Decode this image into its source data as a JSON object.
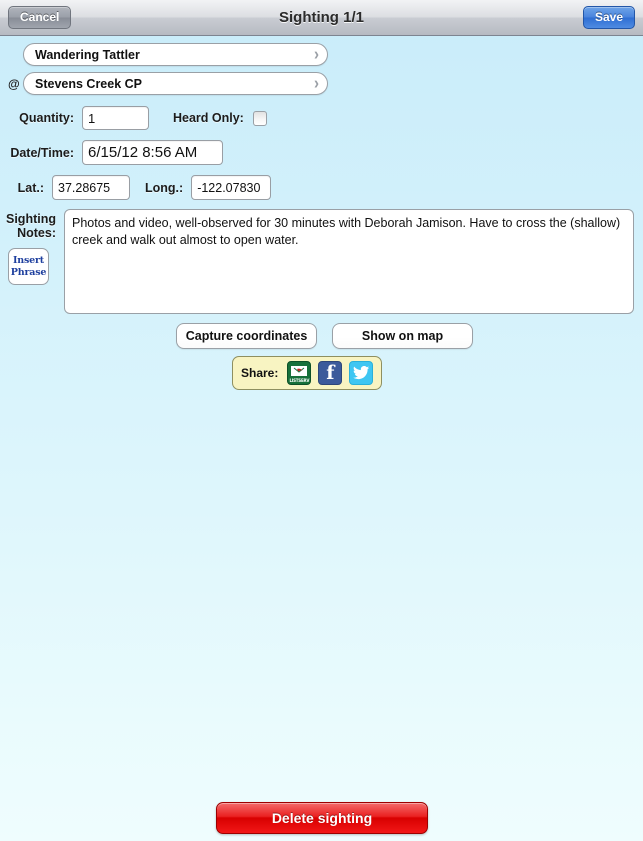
{
  "navbar": {
    "cancel_label": "Cancel",
    "title": "Sighting 1/1",
    "save_label": "Save"
  },
  "form": {
    "species": {
      "value": "Wandering Tattler",
      "chevron": "›"
    },
    "location": {
      "at_symbol": "@",
      "value": "Stevens Creek CP",
      "chevron": "›"
    },
    "quantity": {
      "label": "Quantity:",
      "value": "1"
    },
    "heard_only": {
      "label": "Heard Only:",
      "checked": false
    },
    "datetime": {
      "label": "Date/Time:",
      "value": "6/15/12 8:56 AM"
    },
    "latitude": {
      "label": "Lat.:",
      "value": "37.28675"
    },
    "longitude": {
      "label": "Long.:",
      "value": "-122.07830"
    },
    "notes": {
      "label_line1": "Sighting",
      "label_line2": "Notes:",
      "value": "Photos and video, well-observed for 30 minutes with Deborah Jamison. Have to cross the (shallow) creek and walk out almost to open water."
    },
    "insert_phrase": {
      "line1": "Insert",
      "line2": "Phrase"
    }
  },
  "actions": {
    "capture_coordinates": "Capture coordinates",
    "show_on_map": "Show on map"
  },
  "share": {
    "label": "Share:",
    "items": [
      {
        "name": "listserv-icon",
        "caption": "LISTSERV"
      },
      {
        "name": "facebook-icon",
        "glyph": "f"
      },
      {
        "name": "twitter-icon",
        "glyph": ""
      }
    ]
  },
  "delete": {
    "label": "Delete sighting"
  },
  "colors": {
    "background_top": "#c9ecfa",
    "background_bottom": "#effdfe",
    "save_blue": "#3b7ada",
    "delete_red": "#e51414",
    "share_yellow": "#f8f4c2",
    "listserv_green": "#17703a",
    "facebook_blue": "#3b5a9b",
    "twitter_blue": "#3ec6f2",
    "insert_phrase_blue": "#1e3f9e"
  }
}
